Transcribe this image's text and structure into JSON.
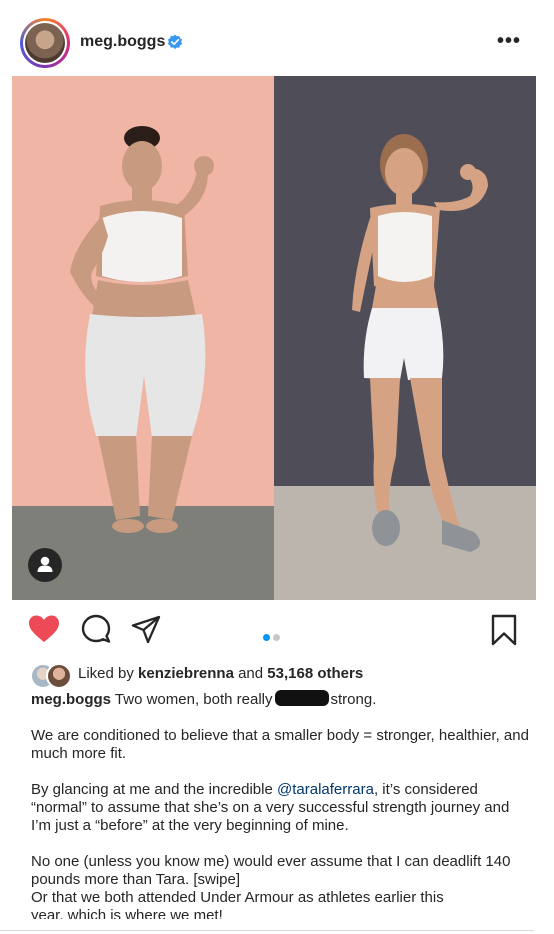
{
  "header": {
    "username": "meg.boggs",
    "more_icon": "more-horizontal-icon",
    "verified_icon": "verified-badge-icon"
  },
  "colors": {
    "like_red": "#ed4956",
    "accent_blue": "#0095f6",
    "verified_blue": "#3897f0",
    "mention_blue": "#00376b"
  },
  "actions": {
    "like_icon": "heart-filled-icon",
    "comment_icon": "comment-icon",
    "share_icon": "share-icon",
    "save_icon": "bookmark-icon",
    "carousel_pages": 2,
    "carousel_active": 1
  },
  "likes": {
    "prefix": "Liked by",
    "liker": "kenziebrenna",
    "and": "and",
    "count": "53,168 others"
  },
  "caption": {
    "username": "meg.boggs",
    "line1_before": "Two women, both really",
    "line1_after": "strong.",
    "para2": "We are conditioned to believe that a smaller body = stronger, healthier, and much more fit.",
    "para3_before": "By glancing at me and the incredible",
    "para3_mention": "@taralaferrara",
    "para3_after": ", it’s considered “normal” to assume that she’s on a very successful strength journey and I’m just a “before” at the very beginning of mine.",
    "para4": "No one (unless you know me) would ever assume that I can deadlift 140 pounds more than Tara. [swipe]",
    "para5": "Or that we both attended Under Armour as athletes earlier this",
    "para5_cut": "year, which is where we met!"
  }
}
